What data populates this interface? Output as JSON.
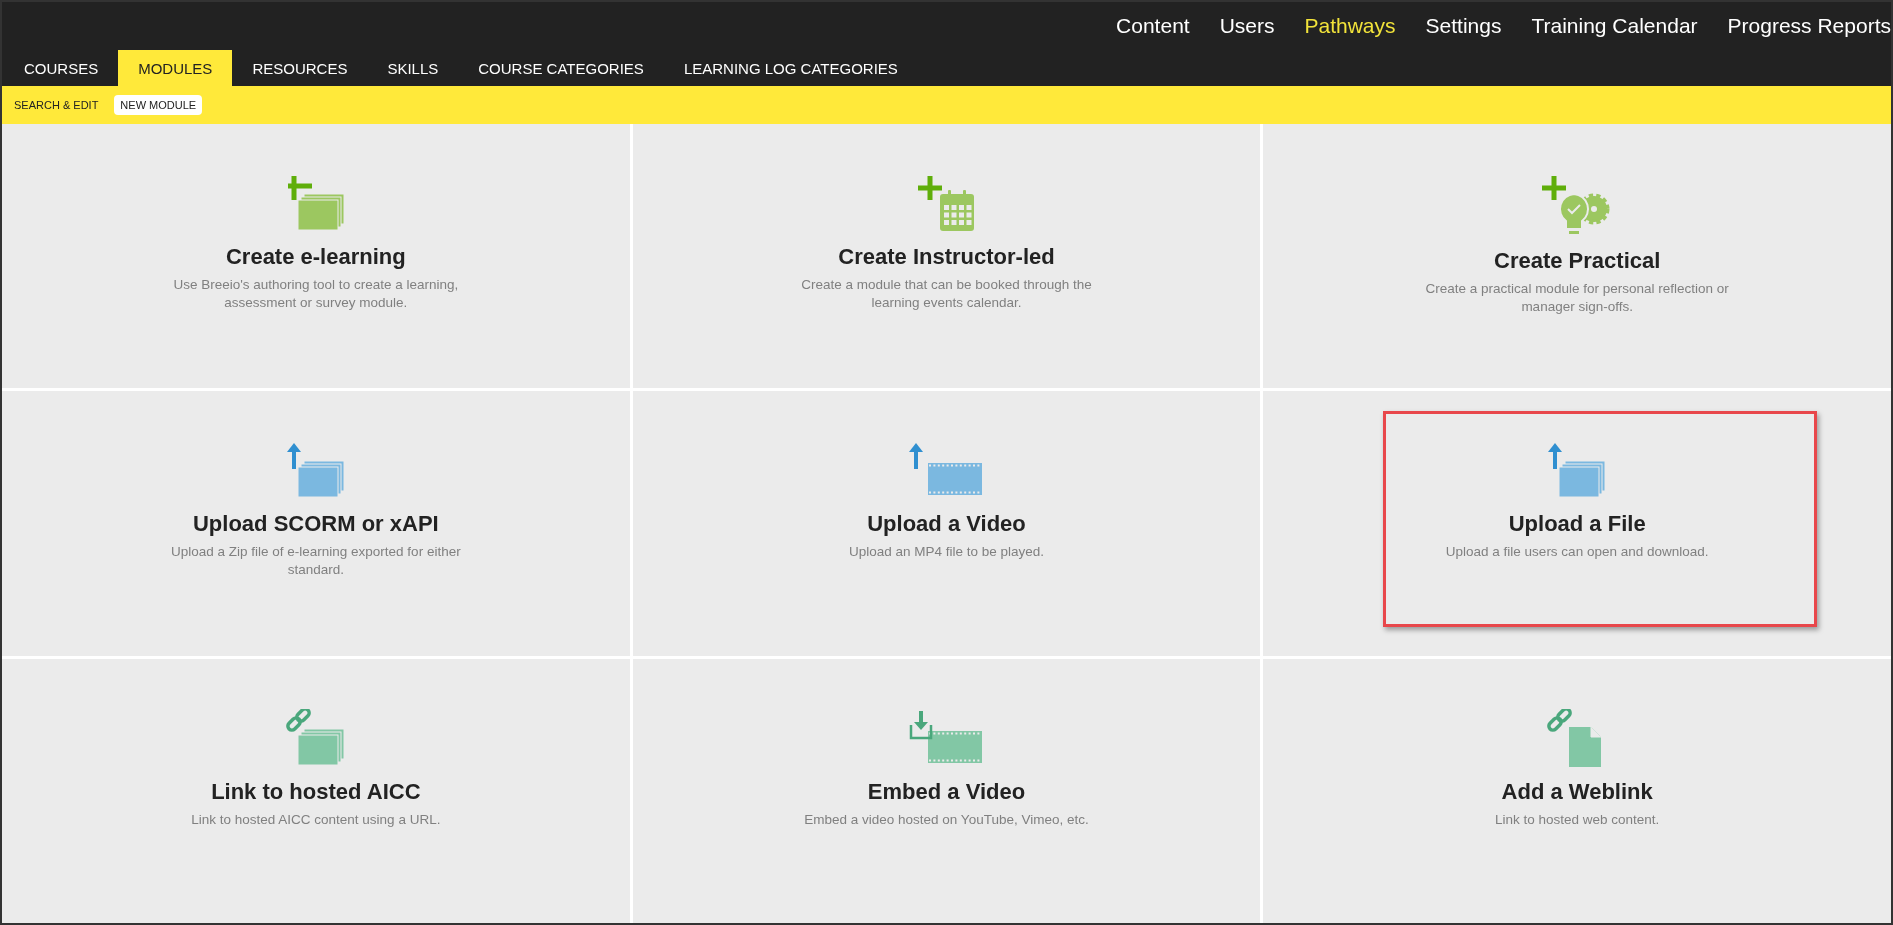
{
  "top_nav": [
    {
      "label": "Content",
      "selected": false
    },
    {
      "label": "Users",
      "selected": false
    },
    {
      "label": "Pathways",
      "selected": true
    },
    {
      "label": "Settings",
      "selected": false
    },
    {
      "label": "Training Calendar",
      "selected": false
    },
    {
      "label": "Progress Reports",
      "selected": false
    }
  ],
  "tabs": [
    {
      "label": "COURSES",
      "selected": false
    },
    {
      "label": "MODULES",
      "selected": true
    },
    {
      "label": "RESOURCES",
      "selected": false
    },
    {
      "label": "SKILLS",
      "selected": false
    },
    {
      "label": "COURSE CATEGORIES",
      "selected": false
    },
    {
      "label": "LEARNING LOG CATEGORIES",
      "selected": false
    }
  ],
  "sub_tabs": [
    {
      "label": "SEARCH & EDIT",
      "selected": false
    },
    {
      "label": "NEW MODULE",
      "selected": true
    }
  ],
  "cards": [
    {
      "kind": "stack-plus",
      "title": "Create e-learning",
      "description": "Use Breeio's authoring tool to create a learning, assessment or survey module.",
      "highlighted": false
    },
    {
      "kind": "calendar-plus",
      "title": "Create Instructor-led",
      "description": "Create a module that can be booked through the learning events calendar.",
      "highlighted": false
    },
    {
      "kind": "bulb-plus",
      "title": "Create Practical",
      "description": "Create a practical module for personal reflection or manager sign-offs.",
      "highlighted": false
    },
    {
      "kind": "stack-upload",
      "title": "Upload SCORM or xAPI",
      "description": "Upload a Zip file of e-learning exported for either standard.",
      "highlighted": false
    },
    {
      "kind": "film-upload",
      "title": "Upload a Video",
      "description": "Upload an MP4 file to be played.",
      "highlighted": false
    },
    {
      "kind": "stack-upload",
      "title": "Upload a File",
      "description": "Upload a file users can open and download.",
      "highlighted": true
    },
    {
      "kind": "stack-link",
      "title": "Link to hosted AICC",
      "description": "Link to hosted AICC content using a URL.",
      "highlighted": false
    },
    {
      "kind": "film-embed",
      "title": "Embed a Video",
      "description": "Embed a video hosted on YouTube, Vimeo, etc.",
      "highlighted": false
    },
    {
      "kind": "doc-link",
      "title": "Add a Weblink",
      "description": "Link to hosted web content.",
      "highlighted": false
    }
  ]
}
